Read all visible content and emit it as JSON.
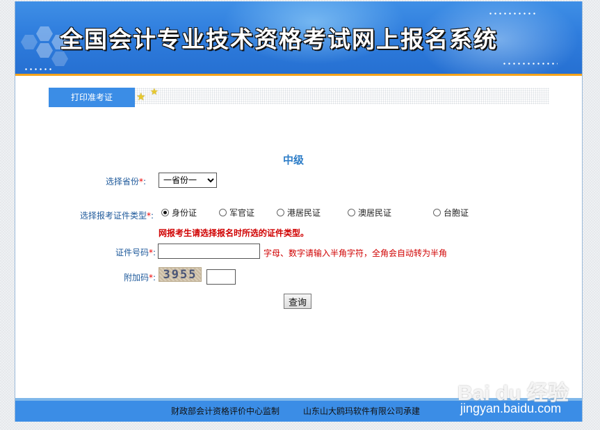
{
  "header": {
    "title": "全国会计专业技术资格考试网上报名系统"
  },
  "tabs": {
    "print_admission": "打印准考证"
  },
  "form": {
    "level": "中级",
    "province_label": "选择省份",
    "province_selected": "一省份一",
    "required_mark": "*",
    "colon": ":",
    "id_type_label": "选择报考证件类型",
    "id_types": [
      {
        "label": "身份证",
        "checked": true
      },
      {
        "label": "军官证",
        "checked": false
      },
      {
        "label": "港居民证",
        "checked": false
      },
      {
        "label": "澳居民证",
        "checked": false
      },
      {
        "label": "台胞证",
        "checked": false
      }
    ],
    "id_type_notice": "网报考生请选择报名时所选的证件类型。",
    "id_number_label": "证件号码",
    "id_number_value": "",
    "id_number_hint": "字母、数字请输入半角字符，全角会自动转为半角",
    "captcha_label": "附加码",
    "captcha_text": "3955",
    "captcha_value": "",
    "query_button": "查询"
  },
  "footer": {
    "supervisor": "财政部会计资格评价中心监制",
    "builder": "山东山大鸥玛软件有限公司承建"
  },
  "watermark": {
    "logo": "Bai du 经验",
    "url": "jingyan.baidu.com"
  }
}
